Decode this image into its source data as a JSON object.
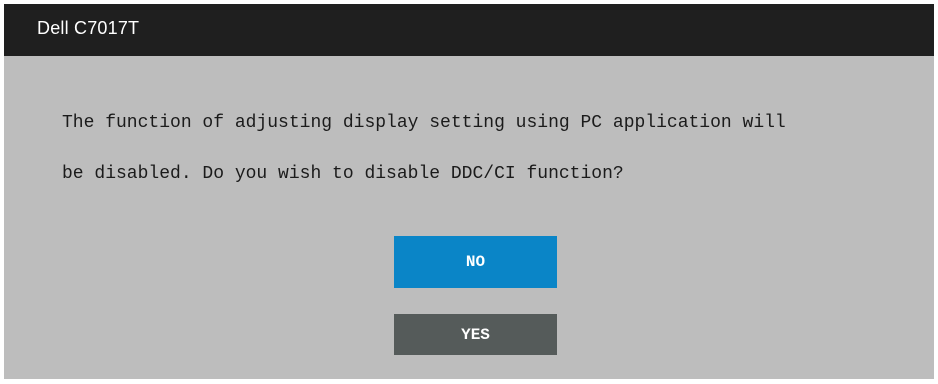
{
  "window": {
    "title": "Dell  C7017T"
  },
  "dialog": {
    "message_line1": "The function of adjusting display setting using PC application will",
    "message_line2": "be disabled. Do you wish to disable DDC/CI function?"
  },
  "buttons": {
    "no_label": "NO",
    "yes_label": "YES"
  },
  "colors": {
    "titlebar": "#1f1f1f",
    "dialog_background": "#bdbdbd",
    "no_button": "#0a85c7",
    "yes_button": "#555b5a"
  }
}
